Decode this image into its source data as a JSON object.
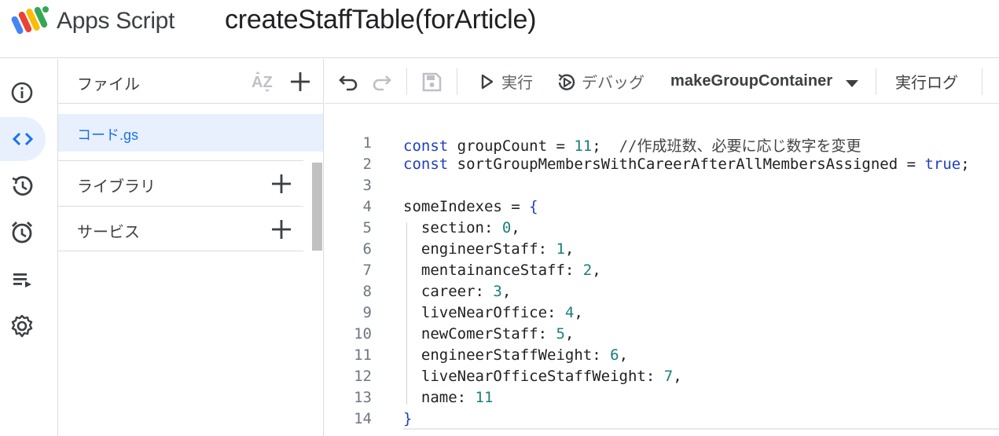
{
  "header": {
    "app_name": "Apps Script",
    "project_title": "createStaffTable(forArticle)"
  },
  "rail": {
    "items": [
      {
        "icon": "info-icon"
      },
      {
        "icon": "code-icon",
        "active": true
      },
      {
        "icon": "history-icon"
      },
      {
        "icon": "alarm-icon"
      },
      {
        "icon": "executions-icon"
      },
      {
        "icon": "gear-icon"
      }
    ]
  },
  "files_panel": {
    "title": "ファイル",
    "file_name": "コード.gs",
    "libraries_label": "ライブラリ",
    "services_label": "サービス"
  },
  "toolbar": {
    "run_label": "実行",
    "debug_label": "デバッグ",
    "function_name": "makeGroupContainer",
    "log_label": "実行ログ"
  },
  "editor": {
    "lines": [
      {
        "n": "1",
        "tokens": [
          [
            "kw",
            "const"
          ],
          [
            "p",
            " groupCount = "
          ],
          [
            "num",
            "11"
          ],
          [
            "p",
            ";  "
          ],
          [
            "cmt",
            "//作成班数、必要に応じ数字を変更"
          ]
        ]
      },
      {
        "n": "2",
        "tokens": [
          [
            "kw",
            "const"
          ],
          [
            "p",
            " sortGroupMembersWithCareerAfterAllMembersAssigned = "
          ],
          [
            "kw",
            "true"
          ],
          [
            "p",
            ";"
          ]
        ]
      },
      {
        "n": "3",
        "tokens": []
      },
      {
        "n": "4",
        "tokens": [
          [
            "p",
            "someIndexes = "
          ],
          [
            "brace",
            "{"
          ]
        ]
      },
      {
        "n": "5",
        "tokens": [
          [
            "p",
            "  section: "
          ],
          [
            "num",
            "0"
          ],
          [
            "p",
            ","
          ]
        ]
      },
      {
        "n": "6",
        "tokens": [
          [
            "p",
            "  engineerStaff: "
          ],
          [
            "num",
            "1"
          ],
          [
            "p",
            ","
          ]
        ]
      },
      {
        "n": "7",
        "tokens": [
          [
            "p",
            "  mentainanceStaff: "
          ],
          [
            "num",
            "2"
          ],
          [
            "p",
            ","
          ]
        ]
      },
      {
        "n": "8",
        "tokens": [
          [
            "p",
            "  career: "
          ],
          [
            "num",
            "3"
          ],
          [
            "p",
            ","
          ]
        ]
      },
      {
        "n": "9",
        "tokens": [
          [
            "p",
            "  liveNearOffice: "
          ],
          [
            "num",
            "4"
          ],
          [
            "p",
            ","
          ]
        ]
      },
      {
        "n": "10",
        "tokens": [
          [
            "p",
            "  newComerStaff: "
          ],
          [
            "num",
            "5"
          ],
          [
            "p",
            ","
          ]
        ]
      },
      {
        "n": "11",
        "tokens": [
          [
            "p",
            "  engineerStaffWeight: "
          ],
          [
            "num",
            "6"
          ],
          [
            "p",
            ","
          ]
        ]
      },
      {
        "n": "12",
        "tokens": [
          [
            "p",
            "  liveNearOfficeStaffWeight: "
          ],
          [
            "num",
            "7"
          ],
          [
            "p",
            ","
          ]
        ]
      },
      {
        "n": "13",
        "tokens": [
          [
            "p",
            "  name: "
          ],
          [
            "num",
            "11"
          ]
        ]
      },
      {
        "n": "14",
        "tokens": [
          [
            "brace",
            "}"
          ]
        ]
      }
    ]
  }
}
